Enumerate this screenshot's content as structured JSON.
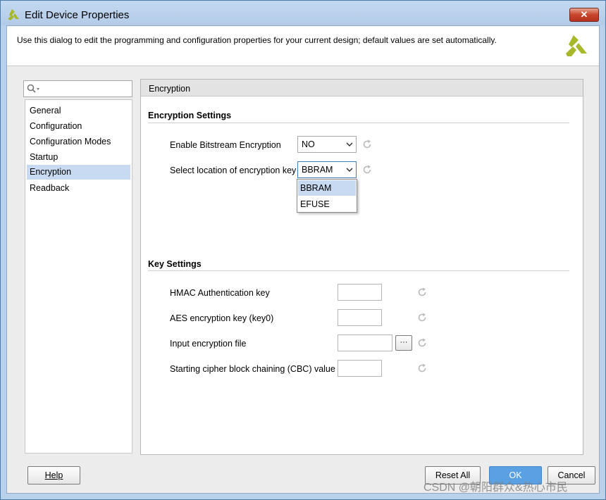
{
  "window": {
    "title": "Edit Device Properties",
    "close_symbol": "✕",
    "description": "Use this dialog to edit the programming and configuration properties for your current design; default values are set automatically."
  },
  "search": {
    "placeholder": ""
  },
  "nav": {
    "items": [
      "General",
      "Configuration",
      "Configuration Modes",
      "Startup",
      "Encryption",
      "Readback"
    ],
    "selected": "Encryption"
  },
  "panel": {
    "title": "Encryption",
    "encryption_settings": {
      "heading": "Encryption Settings",
      "enable_label": "Enable Bitstream Encryption",
      "enable_value": "NO",
      "key_location_label": "Select location of encryption key",
      "key_location_value": "BBRAM",
      "key_location_options": [
        "BBRAM",
        "EFUSE"
      ]
    },
    "key_settings": {
      "heading": "Key Settings",
      "hmac_label": "HMAC Authentication key",
      "hmac_value": "",
      "aes_label": "AES encryption key (key0)",
      "aes_value": "",
      "file_label": "Input encryption file",
      "file_value": "",
      "browse_label": "···",
      "cbc_label": "Starting cipher block chaining (CBC) value",
      "cbc_value": ""
    }
  },
  "buttons": {
    "help": "Help",
    "reset_all": "Reset All",
    "ok": "OK",
    "cancel": "Cancel"
  },
  "watermark": "CSDN @朝阳群众&热心市民",
  "colors": {
    "accent": "#5aa1e4",
    "selection": "#c7daf2",
    "logo": "#a7b82a"
  },
  "icons": {
    "app": "xilinx-logo-icon",
    "search": "search-icon",
    "refresh": "refresh-icon",
    "chevron": "chevron-down-icon"
  }
}
